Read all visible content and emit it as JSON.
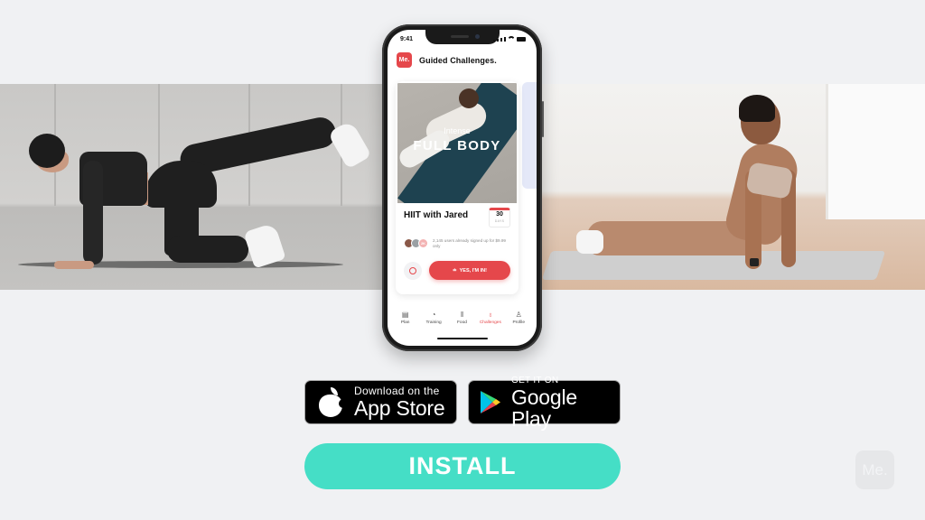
{
  "phone": {
    "status_bar": {
      "time": "9:41"
    },
    "app": {
      "logo_text": "Me.",
      "title": "Guided Challenges.",
      "accent_color": "#e5474b"
    },
    "challenge_card": {
      "subtitle": "Intense",
      "title": "FULL BODY",
      "name": "HIIT with Jared",
      "duration_value": "30",
      "duration_unit": "DAYS",
      "avatar_extra_count": "2K",
      "signup_text": "2,145 users already signed up for $9.99 only",
      "info_button_icon": "info-icon",
      "cta_label": "YES, I'M IN!"
    },
    "tab_bar": {
      "items": [
        {
          "label": "Plan",
          "icon": "calendar-icon",
          "glyph": "▤",
          "active": false
        },
        {
          "label": "Training",
          "icon": "training-icon",
          "glyph": "◔",
          "active": false
        },
        {
          "label": "Food",
          "icon": "cutlery-icon",
          "glyph": "‖",
          "active": false
        },
        {
          "label": "Challenges",
          "icon": "trophy-icon",
          "glyph": "♁",
          "active": true
        },
        {
          "label": "Profile",
          "icon": "profile-icon",
          "glyph": "♙",
          "active": false
        }
      ]
    }
  },
  "store_badges": {
    "apple": {
      "small": "Download on the",
      "large": "App Store"
    },
    "google": {
      "small": "GET IT ON",
      "large": "Google Play"
    }
  },
  "install_button": {
    "label": "INSTALL",
    "color": "#45dec6"
  },
  "watermark": {
    "text": "Me."
  }
}
